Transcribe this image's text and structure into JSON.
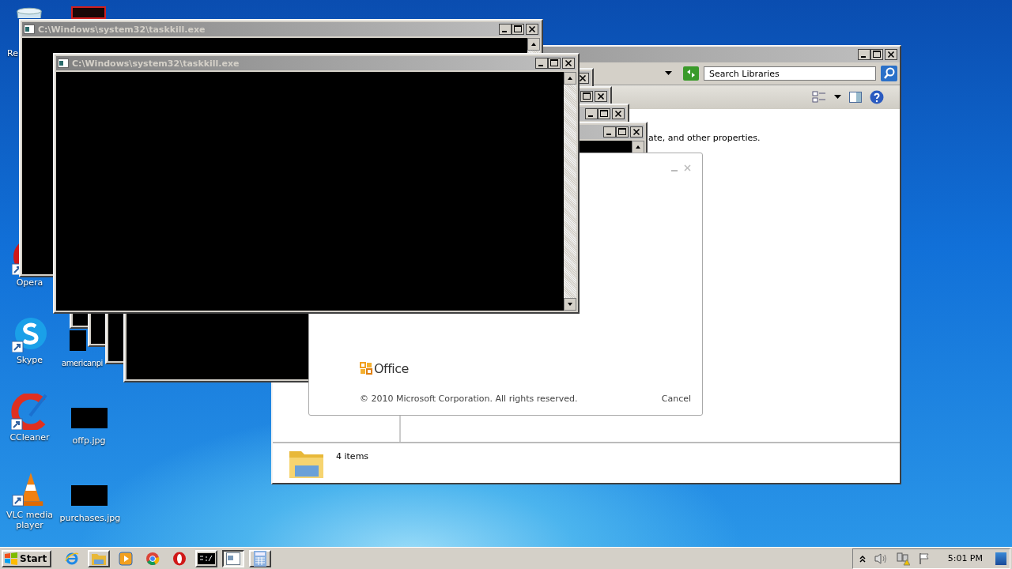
{
  "desktop_icons": [
    {
      "label": "Re",
      "kind": "recycle"
    },
    {
      "label": "Opera",
      "kind": "opera"
    },
    {
      "label": "Skype",
      "kind": "skype"
    },
    {
      "label": "CCleaner",
      "kind": "ccleaner"
    },
    {
      "label": "VLC media player",
      "kind": "vlc"
    },
    {
      "label": "americanpi",
      "kind": "image_partial"
    },
    {
      "label": "offp.jpg",
      "kind": "image"
    },
    {
      "label": "purchases.jpg",
      "kind": "image"
    }
  ],
  "explorer": {
    "search": {
      "placeholder": "Search Libraries"
    },
    "description": "ate, and other properties.",
    "status": "4 items"
  },
  "office_splash": {
    "logo_text": "Office",
    "copyright": "© 2010 Microsoft Corporation.  All rights reserved.",
    "cancel": "Cancel"
  },
  "consoles": [
    {
      "title": "C:\\Windows\\system32\\taskkill.exe"
    },
    {
      "title": "C:\\Windows\\system32\\taskkill.exe"
    }
  ],
  "taskbar": {
    "start": "Start",
    "apps": [
      {
        "kind": "ie",
        "selected": false
      },
      {
        "kind": "explorer",
        "selected": false
      },
      {
        "kind": "media",
        "selected": false
      },
      {
        "kind": "chrome",
        "selected": false
      },
      {
        "kind": "opera",
        "selected": false
      },
      {
        "kind": "cmd",
        "selected": false
      },
      {
        "kind": "window",
        "selected": true
      },
      {
        "kind": "calculator",
        "selected": false
      }
    ],
    "clock": "5:01 PM"
  }
}
